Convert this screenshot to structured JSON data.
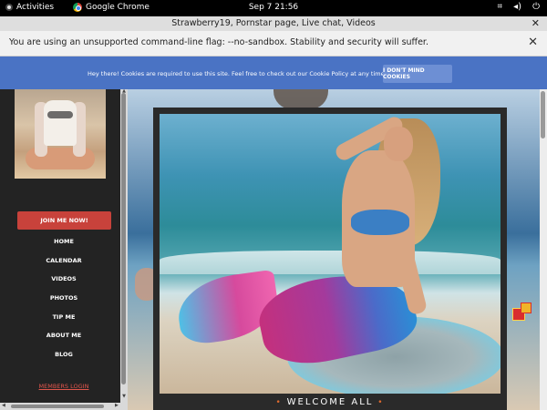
{
  "topbar": {
    "activities": "Activities",
    "app_name": "Google Chrome",
    "clock": "Sep 7  21:56",
    "network_icon": "network-icon",
    "sound_icon": "volume-icon",
    "power_icon": "power-icon"
  },
  "window": {
    "title": "Strawberry19, Pornstar page, Live chat, Videos",
    "close_glyph": "✕"
  },
  "infobar": {
    "message": "You are using an unsupported command-line flag: --no-sandbox. Stability and security will suffer.",
    "close_glyph": "✕"
  },
  "cookie": {
    "text": "Hey there! Cookies are required to use this site. Feel free to check out our Cookie Policy at any time.",
    "button": "I DON'T MIND COOKIES"
  },
  "sidebar": {
    "join_button": "JOIN ME NOW!",
    "menu": [
      "HOME",
      "CALENDAR",
      "VIDEOS",
      "PHOTOS",
      "TIP ME",
      "ABOUT ME",
      "BLOG"
    ],
    "members_login": "MEMBERS LOGIN"
  },
  "main": {
    "welcome": "WELCOME ALL"
  },
  "colors": {
    "cookie_bar": "#4a73c4",
    "join_button": "#c8423b",
    "members_link": "#e0564c",
    "sidebar_bg": "#232323"
  }
}
